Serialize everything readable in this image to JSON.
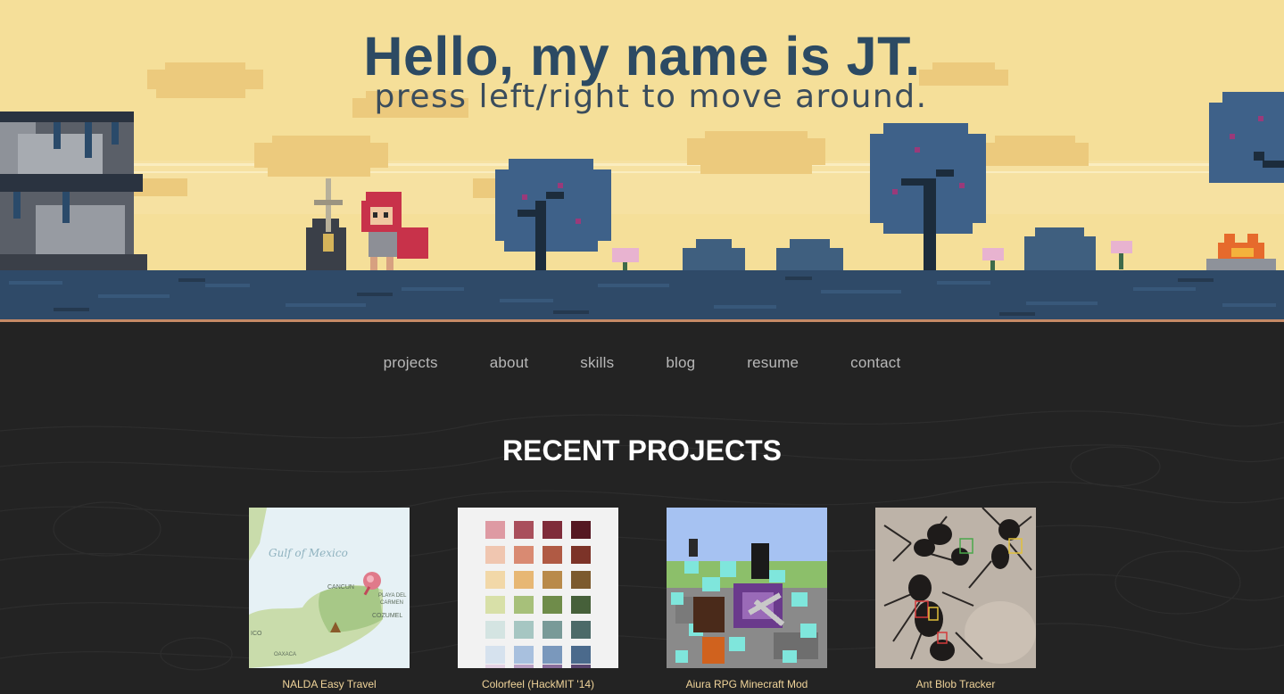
{
  "hero": {
    "title": "Hello, my name is JT.",
    "subtitle": "press left/right to move around."
  },
  "nav": {
    "items": [
      {
        "label": "projects"
      },
      {
        "label": "about"
      },
      {
        "label": "skills"
      },
      {
        "label": "blog"
      },
      {
        "label": "resume"
      },
      {
        "label": "contact"
      }
    ]
  },
  "projects": {
    "heading": "RECENT PROJECTS",
    "items": [
      {
        "title": "NALDA Easy Travel",
        "map_labels": [
          "Gulf of Mexico",
          "CANCUN",
          "PLAYA DEL",
          "CARMEN",
          "COZUMEL",
          "OAXACA",
          "ICO"
        ]
      },
      {
        "title": "Colorfeel (HackMIT '14)"
      },
      {
        "title": "Aiura RPG Minecraft Mod"
      },
      {
        "title": "Ant Blob Tracker"
      }
    ]
  },
  "colors": {
    "sky": "#f5df99",
    "ground": "#2f4a68",
    "title": "#2c4a63",
    "page_bg": "#232323",
    "nav_text": "#b8b8b8",
    "card_title": "#f0d49a",
    "accent_line": "#c58a66"
  }
}
